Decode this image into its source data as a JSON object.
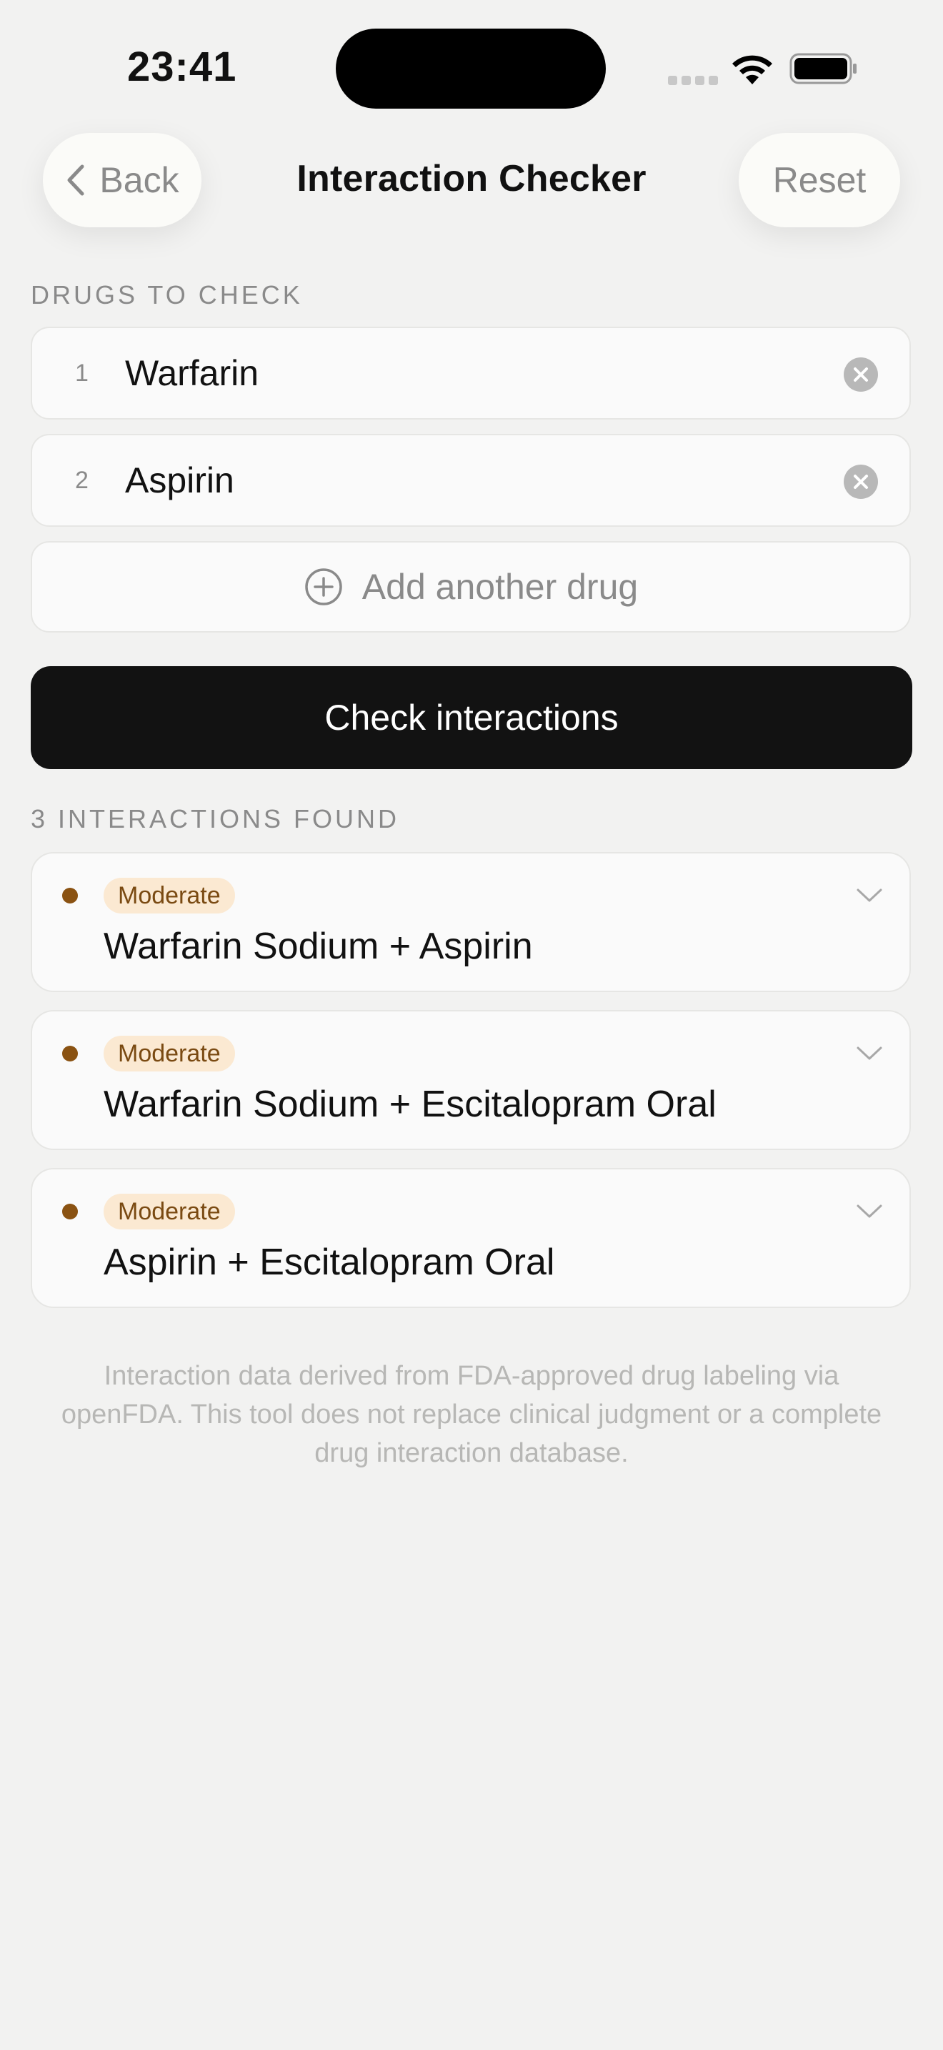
{
  "status_bar": {
    "time": "23:41"
  },
  "nav": {
    "back_label": "Back",
    "title": "Interaction Checker",
    "reset_label": "Reset"
  },
  "drugs_section": {
    "label": "DRUGS TO CHECK",
    "drugs": [
      {
        "index": "1",
        "name": "Warfarin"
      },
      {
        "index": "2",
        "name": "Aspirin"
      }
    ],
    "add_label": "Add another drug"
  },
  "check_button_label": "Check interactions",
  "results": {
    "label": "3 INTERACTIONS FOUND",
    "interactions": [
      {
        "severity": "Moderate",
        "title": "Warfarin Sodium + Aspirin"
      },
      {
        "severity": "Moderate",
        "title": "Warfarin Sodium + Escitalopram Oral"
      },
      {
        "severity": "Moderate",
        "title": "Aspirin + Escitalopram Oral"
      }
    ]
  },
  "footer": "Interaction data derived from FDA-approved drug labeling via openFDA. This tool does not replace clinical judgment or a complete drug interaction database.",
  "colors": {
    "background": "#f2f2f1",
    "primary_button": "#121212",
    "severity_moderate_dot": "#8a5212",
    "severity_moderate_badge_bg": "#fbe9d2",
    "severity_moderate_badge_text": "#7a4a12"
  },
  "icons": {
    "back": "chevron-left-icon",
    "clear": "clear-circle-icon",
    "add": "plus-circle-icon",
    "expand": "chevron-down-icon",
    "wifi": "wifi-icon",
    "battery": "battery-icon"
  }
}
